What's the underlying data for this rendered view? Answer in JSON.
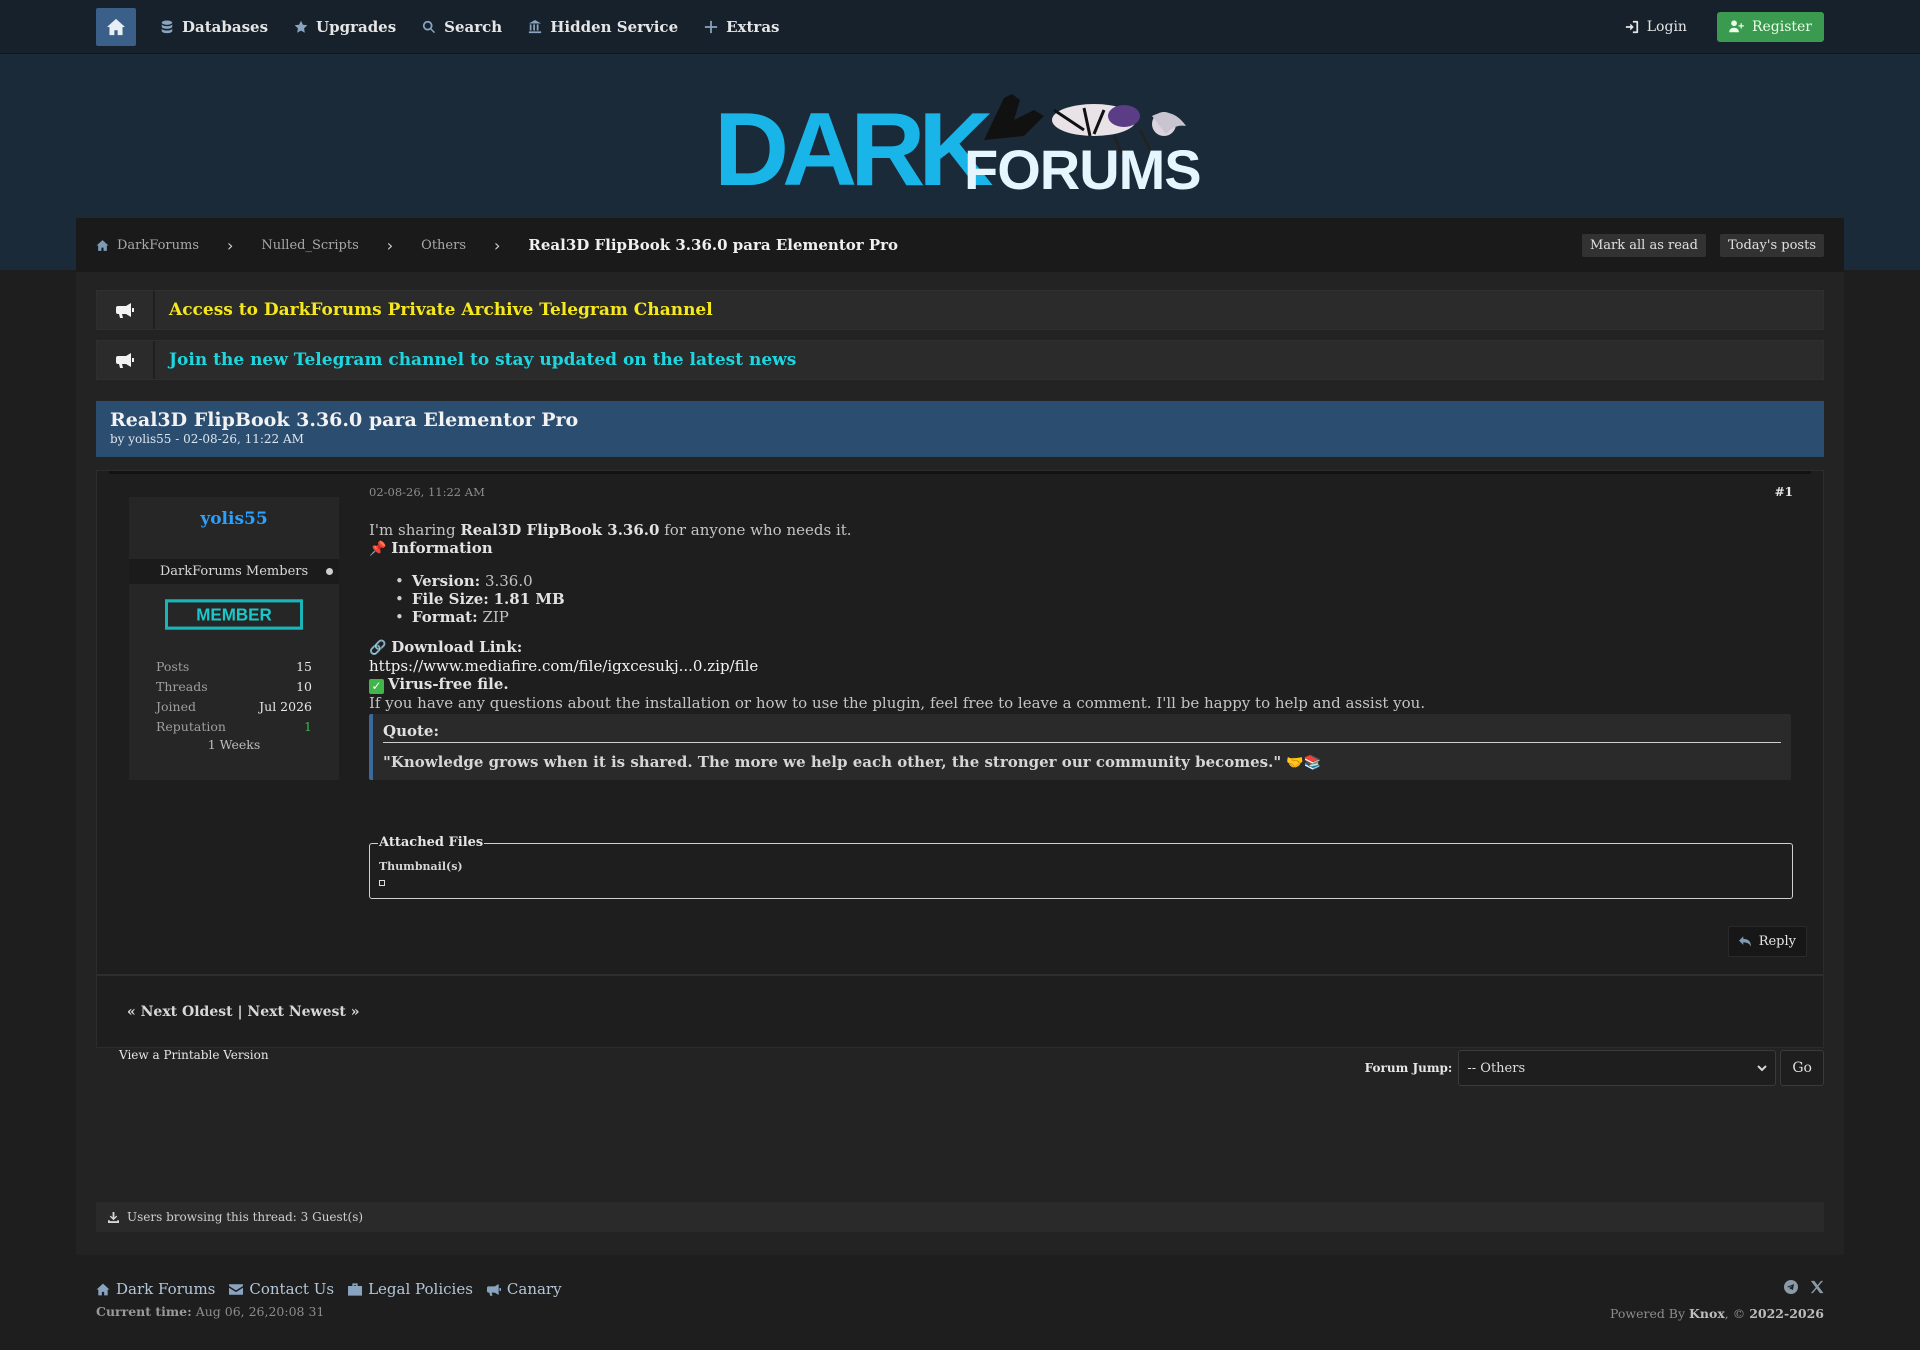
{
  "nav": {
    "items": [
      {
        "label": "Databases",
        "icon": "database-icon"
      },
      {
        "label": "Upgrades",
        "icon": "star-icon"
      },
      {
        "label": "Search",
        "icon": "search-icon"
      },
      {
        "label": "Hidden Service",
        "icon": "landmark-icon"
      },
      {
        "label": "Extras",
        "icon": "plus-icon"
      }
    ],
    "login": "Login",
    "register": "Register"
  },
  "logo": {
    "word1": "DARK",
    "word2": "FORUMS"
  },
  "breadcrumb": {
    "items": [
      "DarkForums",
      "Nulled_Scripts",
      "Others"
    ],
    "current": "Real3D FlipBook 3.36.0 para Elementor Pro",
    "mark_all_read": "Mark all as read",
    "todays_posts": "Today's posts"
  },
  "announcements": [
    {
      "text": "Access to DarkForums Private Archive Telegram Channel",
      "color": "#f5e81c"
    },
    {
      "text": "Join the new Telegram channel to stay updated on the latest news",
      "color": "#1ed6e0"
    }
  ],
  "thread": {
    "title": "Real3D FlipBook 3.36.0 para Elementor Pro",
    "byline": "by yolis55 - 02-08-26, 11:22 AM"
  },
  "user": {
    "name": "yolis55",
    "group": "DarkForums Members",
    "badge": "MEMBER",
    "stats": [
      {
        "k": "Posts",
        "v": "15"
      },
      {
        "k": "Threads",
        "v": "10"
      },
      {
        "k": "Joined",
        "v": "Jul 2026"
      },
      {
        "k": "Reputation",
        "v": "1"
      }
    ],
    "weeks": "1 Weeks"
  },
  "post": {
    "date": "02-08-26, 11:22 AM",
    "number": "#1",
    "intro_pre": "I'm sharing ",
    "intro_bold": "Real3D FlipBook 3.36.0",
    "intro_post": " for anyone who needs it.",
    "info_heading": "Information",
    "specs": [
      {
        "k": "Version:",
        "v": "3.36.0",
        "bold": false
      },
      {
        "k": "File Size:",
        "v": "1.81 MB",
        "bold": true
      },
      {
        "k": "Format:",
        "v": "ZIP",
        "bold": false
      }
    ],
    "download_heading": "Download Link:",
    "download_url": "https://www.mediafire.com/file/igxcesukj...0.zip/file",
    "virus_free": "Virus-free file.",
    "help_text": "If you have any questions about the installation or how to use the plugin, feel free to leave a comment. I'll be happy to help and assist you.",
    "quote_label": "Quote:",
    "quote_text": "\"Knowledge grows when it is shared. The more we help each other, the stronger our community becomes.\"",
    "attached_label": "Attached Files",
    "thumbnails_label": "Thumbnail(s)",
    "reply": "Reply"
  },
  "pagination": {
    "prev": "« Next Oldest",
    "sep": "|",
    "next": "Next Newest »"
  },
  "printable": "View a Printable Version",
  "forum_jump": {
    "label": "Forum Jump:",
    "selected": "-- Others",
    "go": "Go"
  },
  "browsing": "Users browsing this thread: 3 Guest(s)",
  "footer": {
    "links": [
      {
        "label": "Dark Forums",
        "icon": "home-icon"
      },
      {
        "label": "Contact Us",
        "icon": "envelope-icon"
      },
      {
        "label": "Legal Policies",
        "icon": "briefcase-icon"
      },
      {
        "label": "Canary",
        "icon": "bullhorn-icon"
      }
    ],
    "current_time_label": "Current time:",
    "current_time_value": "Aug 06, 26,20:08 31",
    "powered_pre": "Powered By",
    "powered_brand": "Knox",
    "powered_years": "2022-2026"
  }
}
